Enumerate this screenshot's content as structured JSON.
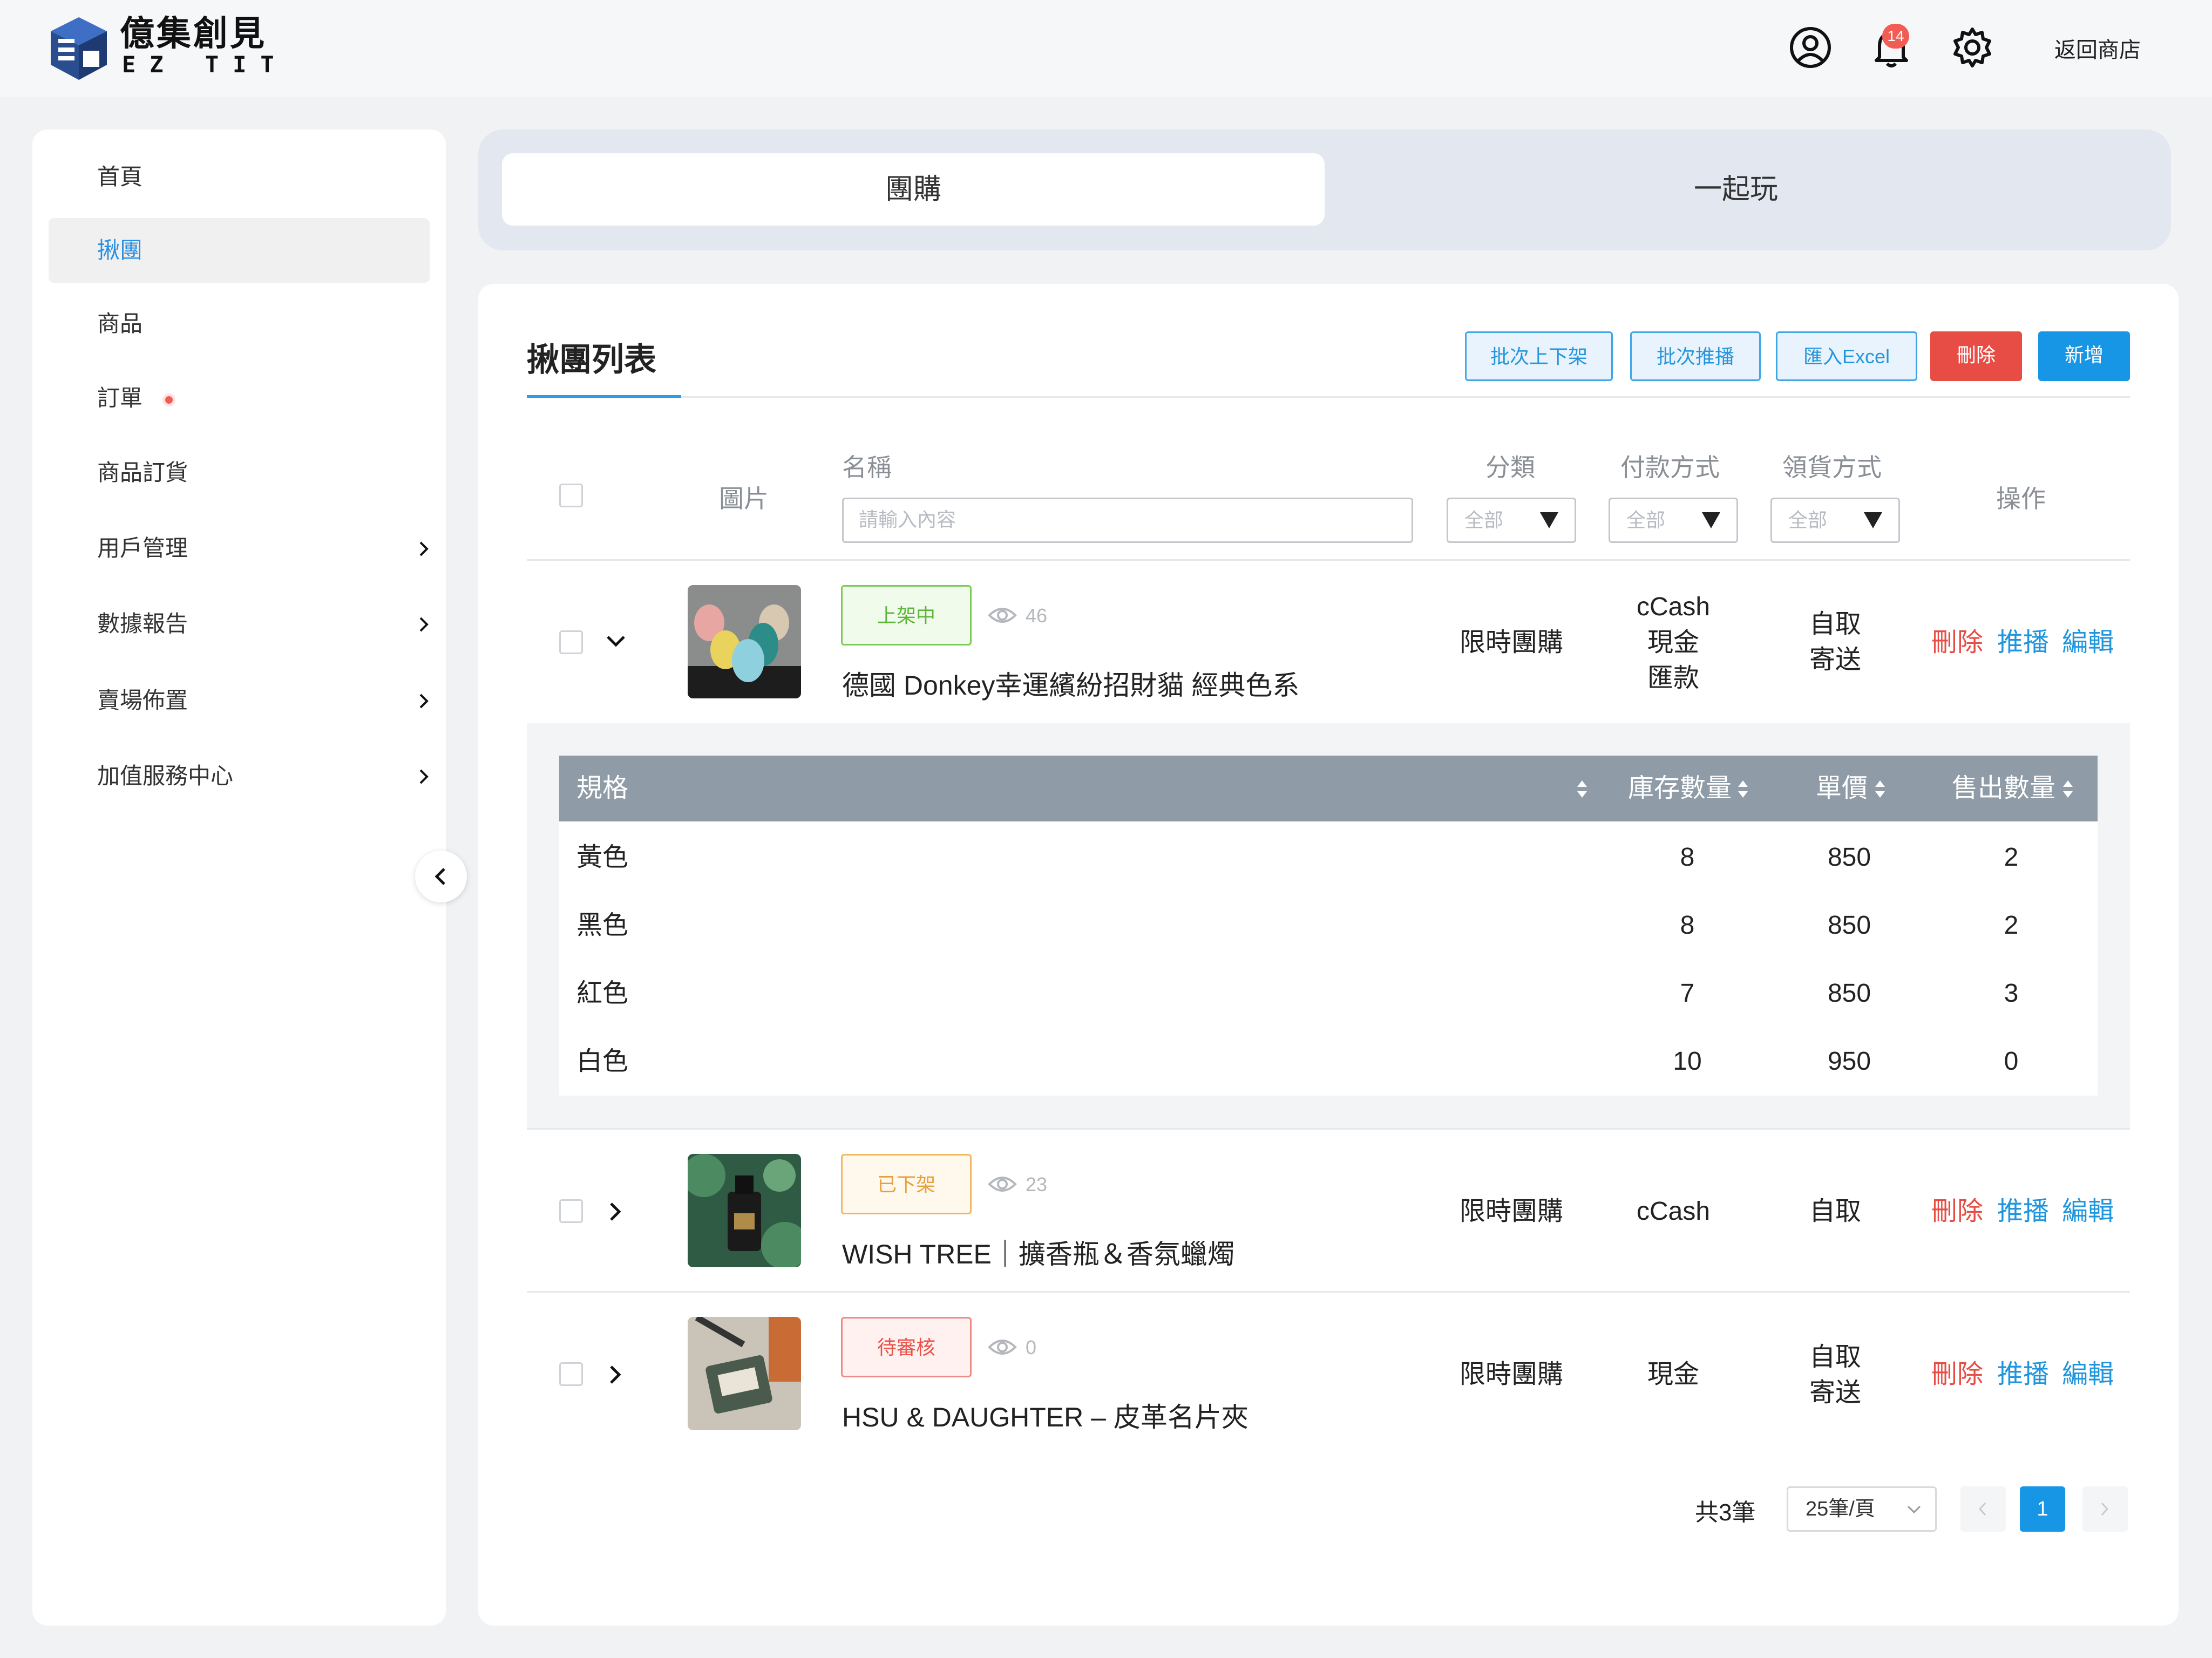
{
  "brand": {
    "name": "億集創見",
    "sub": "EZ TIT"
  },
  "header": {
    "notification_count": "14",
    "return_label": "返回商店"
  },
  "sidebar": {
    "items": [
      {
        "label": "首頁"
      },
      {
        "label": "揪團"
      },
      {
        "label": "商品"
      },
      {
        "label": "訂單"
      },
      {
        "label": "商品訂貨"
      },
      {
        "label": "用戶管理"
      },
      {
        "label": "數據報告"
      },
      {
        "label": "賣場佈置"
      },
      {
        "label": "加值服務中心"
      }
    ]
  },
  "tabs": [
    {
      "label": "團購"
    },
    {
      "label": "一起玩"
    }
  ],
  "page": {
    "title": "揪團列表",
    "buttons": {
      "batch_shelf": "批次上下架",
      "batch_broadcast": "批次推播",
      "import_excel": "匯入Excel",
      "delete": "刪除",
      "add": "新增"
    }
  },
  "table": {
    "headers": {
      "image": "圖片",
      "name": "名稱",
      "category": "分類",
      "payment": "付款方式",
      "delivery": "領貨方式",
      "actions": "操作"
    },
    "name_placeholder": "請輸入內容",
    "filter_all": "全部",
    "action_labels": {
      "delete": "刪除",
      "broadcast": "推播",
      "edit": "編輯"
    },
    "rows": [
      {
        "status": "上架中",
        "views": "46",
        "name": "德國 Donkey幸運繽紛招財貓 經典色系",
        "category": "限時團購",
        "payment": [
          "cCash",
          "現金",
          "匯款"
        ],
        "delivery": [
          "自取",
          "寄送"
        ],
        "expanded": true
      },
      {
        "status": "已下架",
        "views": "23",
        "name": "WISH TREE｜擴香瓶＆香氛蠟燭",
        "category": "限時團購",
        "payment": [
          "cCash"
        ],
        "delivery": [
          "自取"
        ],
        "expanded": false
      },
      {
        "status": "待審核",
        "views": "0",
        "name": "HSU & DAUGHTER – 皮革名片夾",
        "category": "限時團購",
        "payment": [
          "現金"
        ],
        "delivery": [
          "自取",
          "寄送"
        ],
        "expanded": false
      }
    ]
  },
  "variants": {
    "headers": {
      "spec": "規格",
      "stock": "庫存數量",
      "price": "單價",
      "sold": "售出數量"
    },
    "rows": [
      {
        "spec": "黃色",
        "stock": "8",
        "price": "850",
        "sold": "2"
      },
      {
        "spec": "黑色",
        "stock": "8",
        "price": "850",
        "sold": "2"
      },
      {
        "spec": "紅色",
        "stock": "7",
        "price": "850",
        "sold": "3"
      },
      {
        "spec": "白色",
        "stock": "10",
        "price": "950",
        "sold": "0"
      }
    ]
  },
  "pagination": {
    "total": "共3筆",
    "page_size": "25筆/頁",
    "current": "1"
  },
  "colors": {
    "accent": "#1796e6",
    "danger": "#e84d45",
    "sidebar_active": "#2b8fe0"
  }
}
